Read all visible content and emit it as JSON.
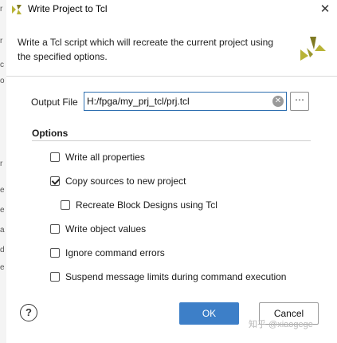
{
  "window": {
    "title": "Write Project to Tcl"
  },
  "background_edge": [
    "r",
    "r",
    "c",
    "o",
    "r",
    "e",
    "e",
    "a",
    "d",
    "e"
  ],
  "header": {
    "description": "Write a Tcl script which will recreate the current project using the specified options.",
    "logo": "vivado-logo-icon"
  },
  "output_file": {
    "label": "Output File",
    "value": "H:/fpga/my_prj_tcl/prj.tcl",
    "browse_label": "⋯"
  },
  "options": {
    "title": "Options",
    "items": [
      {
        "label": "Write all properties",
        "checked": false
      },
      {
        "label": "Copy sources to new project",
        "checked": true
      },
      {
        "label": "Recreate Block Designs using Tcl",
        "checked": false
      },
      {
        "label": "Write object values",
        "checked": false
      },
      {
        "label": "Ignore command errors",
        "checked": false
      },
      {
        "label": "Suspend message limits during command execution",
        "checked": false
      }
    ]
  },
  "footer": {
    "help_label": "?",
    "ok_label": "OK",
    "cancel_label": "Cancel"
  },
  "watermark": "知乎 @xiaogege",
  "colors": {
    "accent": "#3d7fc8",
    "focus_border": "#2e6fb0",
    "logo_yellow": "#b8b336",
    "logo_dark": "#7f7a23"
  }
}
